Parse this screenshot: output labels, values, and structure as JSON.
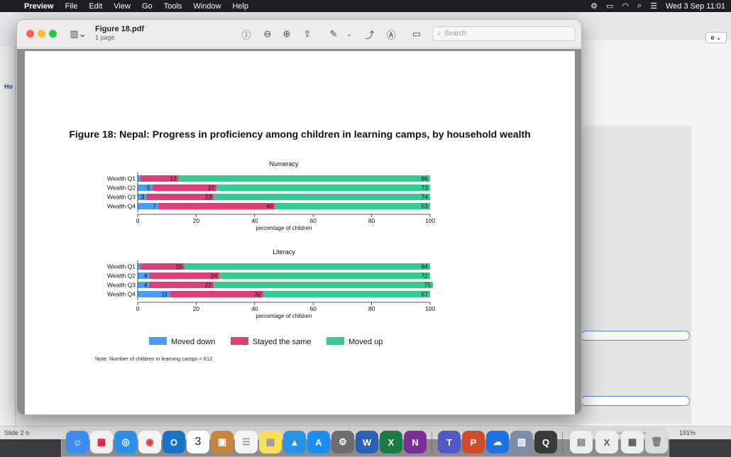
{
  "menubar": {
    "app": "Preview",
    "items": [
      "File",
      "Edit",
      "View",
      "Go",
      "Tools",
      "Window",
      "Help"
    ],
    "clock": "Wed 3 Sep  11:01"
  },
  "window": {
    "title": "Figure 18.pdf",
    "subtitle": "1 page",
    "search_placeholder": "Search"
  },
  "figure": {
    "title": "Figure 18: Nepal: Progress in proficiency among children in learning camps, by household wealth",
    "note": "Note: Number of children in learning camps = 612"
  },
  "chart_data": [
    {
      "type": "bar",
      "orientation": "horizontal",
      "stacked": true,
      "title": "Numeracy",
      "xlabel": "percentage of children",
      "xlim": [
        0,
        100
      ],
      "xticks": [
        0,
        20,
        40,
        60,
        80,
        100
      ],
      "categories": [
        "Wealth Q1",
        "Wealth Q2",
        "Wealth Q3",
        "Wealth Q4"
      ],
      "series": [
        {
          "name": "Moved down",
          "color": "#4a9ff5",
          "values": [
            1,
            5,
            3,
            7
          ]
        },
        {
          "name": "Stayed the same",
          "color": "#de3f78",
          "values": [
            13,
            22,
            23,
            40
          ]
        },
        {
          "name": "Moved up",
          "color": "#35cc94",
          "values": [
            86,
            73,
            74,
            53
          ]
        }
      ],
      "labels": [
        [
          "",
          "5",
          "3",
          "7"
        ],
        [
          "13",
          "22",
          "23",
          "40"
        ],
        [
          "86",
          "73",
          "74",
          "53"
        ]
      ]
    },
    {
      "type": "bar",
      "orientation": "horizontal",
      "stacked": true,
      "title": "Literacy",
      "xlabel": "percentage of children",
      "xlim": [
        0,
        100
      ],
      "xticks": [
        0,
        20,
        40,
        60,
        80,
        100
      ],
      "categories": [
        "Wealth Q1",
        "Wealth Q2",
        "Wealth Q3",
        "Wealth Q4"
      ],
      "series": [
        {
          "name": "Moved down",
          "color": "#4a9ff5",
          "values": [
            1,
            4,
            4,
            11
          ]
        },
        {
          "name": "Stayed the same",
          "color": "#de3f78",
          "values": [
            15,
            24,
            22,
            32
          ]
        },
        {
          "name": "Moved up",
          "color": "#35cc94",
          "values": [
            84,
            72,
            75,
            57
          ]
        }
      ],
      "labels": [
        [
          "",
          "4",
          "4",
          "11"
        ],
        [
          "15",
          "24",
          "22",
          "32"
        ],
        [
          "84",
          "72",
          "75",
          "57"
        ]
      ]
    }
  ],
  "legend": [
    "Moved down",
    "Stayed the same",
    "Moved up"
  ],
  "background_app": {
    "slide_label": "Slide 2 o",
    "zoom": "191%",
    "side_tab": "Ho"
  }
}
